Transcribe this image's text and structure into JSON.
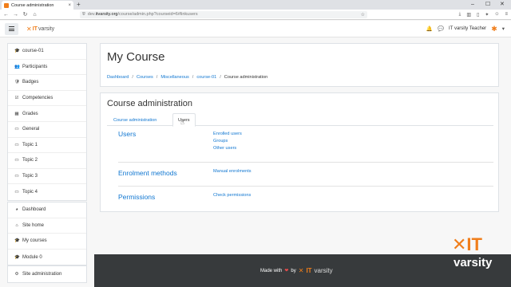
{
  "browser": {
    "tab_title": "Course administration",
    "tab_close": "×",
    "new_tab": "+",
    "win_min": "–",
    "win_max": "☐",
    "win_close": "✕",
    "url_prefix": "dev.",
    "url_domain": "itvarsity.org",
    "url_path": "/course/admin.php?courseid=6#linkusers",
    "nav_back": "←",
    "nav_forward": "→",
    "nav_reload": "↻",
    "nav_home": "⌂"
  },
  "navbar": {
    "brand_x": "✕",
    "brand_it": "IT",
    "brand_varsity": "varsity",
    "user_name": "IT varsity Teacher",
    "bell_glyph": "🔔",
    "chat_glyph": "💬",
    "avatar_glyph": "✱",
    "caret": "▾"
  },
  "sidebar": {
    "group1": [
      {
        "label": "course-01",
        "icon": "graduation-cap-icon",
        "glyph": "🎓"
      },
      {
        "label": "Participants",
        "icon": "users-icon",
        "glyph": "👥"
      },
      {
        "label": "Badges",
        "icon": "shield-icon",
        "glyph": "🛡"
      },
      {
        "label": "Competencies",
        "icon": "checkbox-icon",
        "glyph": "☑"
      },
      {
        "label": "Grades",
        "icon": "table-icon",
        "glyph": "▦"
      },
      {
        "label": "General",
        "icon": "folder-icon",
        "glyph": "▭"
      },
      {
        "label": "Topic 1",
        "icon": "folder-icon",
        "glyph": "▭"
      },
      {
        "label": "Topic 2",
        "icon": "folder-icon",
        "glyph": "▭"
      },
      {
        "label": "Topic 3",
        "icon": "folder-icon",
        "glyph": "▭"
      },
      {
        "label": "Topic 4",
        "icon": "folder-icon",
        "glyph": "▭"
      }
    ],
    "group2": [
      {
        "label": "Dashboard",
        "icon": "dashboard-icon",
        "glyph": "◕"
      },
      {
        "label": "Site home",
        "icon": "home-icon",
        "glyph": "⌂"
      },
      {
        "label": "My courses",
        "icon": "graduation-cap-icon",
        "glyph": "🎓"
      },
      {
        "label": "Module 0",
        "icon": "graduation-cap-icon",
        "glyph": "🎓"
      }
    ],
    "group3": [
      {
        "label": "Site administration",
        "icon": "gear-icon",
        "glyph": "⚙"
      }
    ]
  },
  "header": {
    "title": "My Course",
    "breadcrumb": [
      "Dashboard",
      "Courses",
      "Miscellaneous",
      "course-01"
    ],
    "breadcrumb_current": "Course administration",
    "separator": "/"
  },
  "content": {
    "title": "Course administration",
    "tabs": [
      "Course administration",
      "Users"
    ],
    "cursor_glyph": "☝",
    "sections": [
      {
        "label": "Users",
        "links": [
          "Enrolled users",
          "Groups",
          "Other users"
        ]
      },
      {
        "label": "Enrolment methods",
        "links": [
          "Manual enrolments"
        ]
      },
      {
        "label": "Permissions",
        "links": [
          "Check permissions"
        ]
      }
    ]
  },
  "footer": {
    "made_with": "Made with",
    "heart": "❤",
    "by": "by",
    "brand_x": "✕",
    "brand_it": "IT",
    "brand_varsity": "varsity"
  },
  "watermark": {
    "top": "✕IT",
    "bottom": "varsity"
  },
  "colors": {
    "accent": "#f07e1b",
    "link": "#1177d1",
    "footer_bg": "#373a3c"
  }
}
